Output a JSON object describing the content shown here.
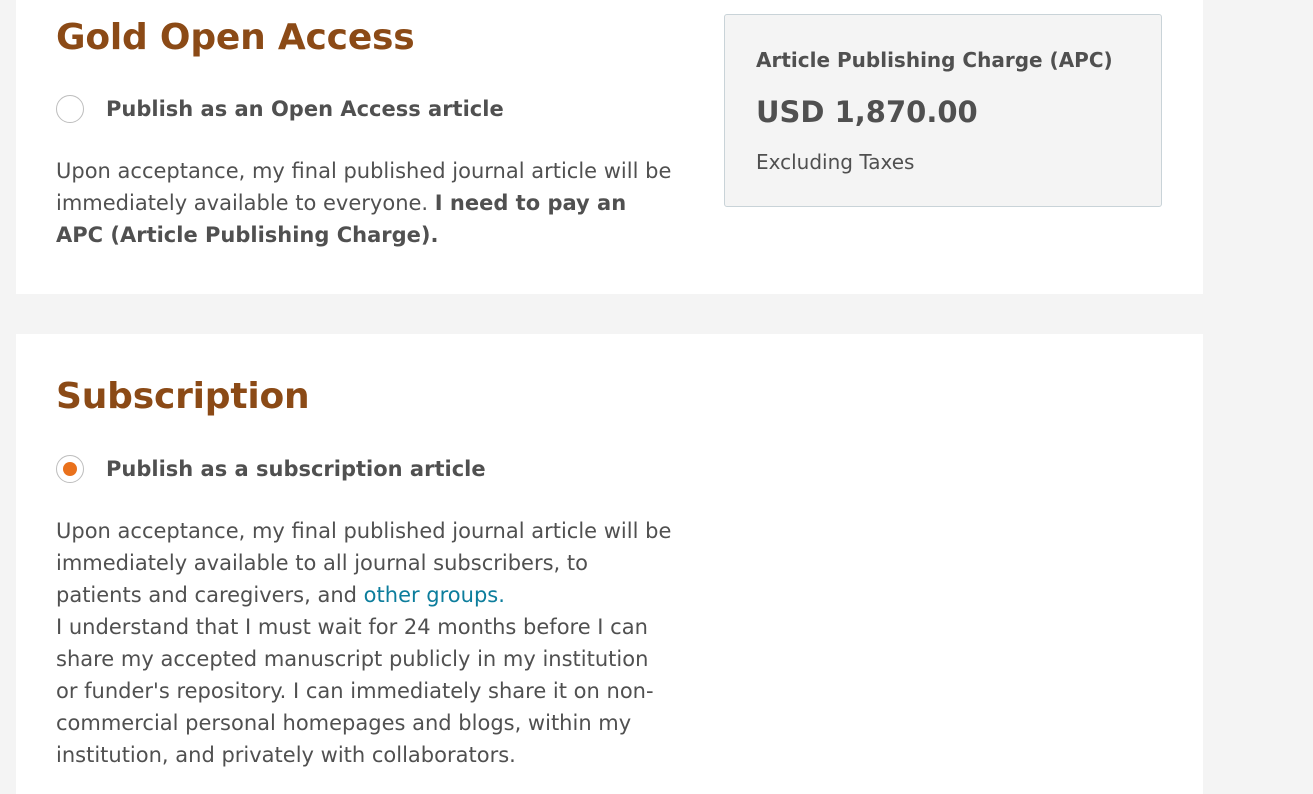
{
  "gold": {
    "title": "Gold Open Access",
    "option_label": "Publish as an Open Access article",
    "selected": false,
    "description_prefix": "Upon acceptance, my final published journal article will be immediately available to everyone. ",
    "description_bold": "I need to pay an APC (Article Publishing Charge)."
  },
  "apc": {
    "title": "Article Publishing Charge (APC)",
    "amount": "USD 1,870.00",
    "note": "Excluding Taxes"
  },
  "subscription": {
    "title": "Subscription",
    "option_label": "Publish as a subscription article",
    "selected": true,
    "description_prefix": "Upon acceptance, my final published journal article will be immediately available to all journal subscribers, to patients and caregivers, and ",
    "link_text": "other groups.",
    "description_rest": "I understand that I must wait for 24 months before I can share my accepted manuscript publicly in my institution or funder's repository. I can immediately share it on non-commercial personal homepages and blogs, within my institution, and privately with collaborators."
  },
  "colors": {
    "heading": "#8b4a16",
    "radio_selected": "#e9711c",
    "link": "#0c7d9c",
    "page_background": "#f4f4f4",
    "card_background": "#ffffff"
  }
}
